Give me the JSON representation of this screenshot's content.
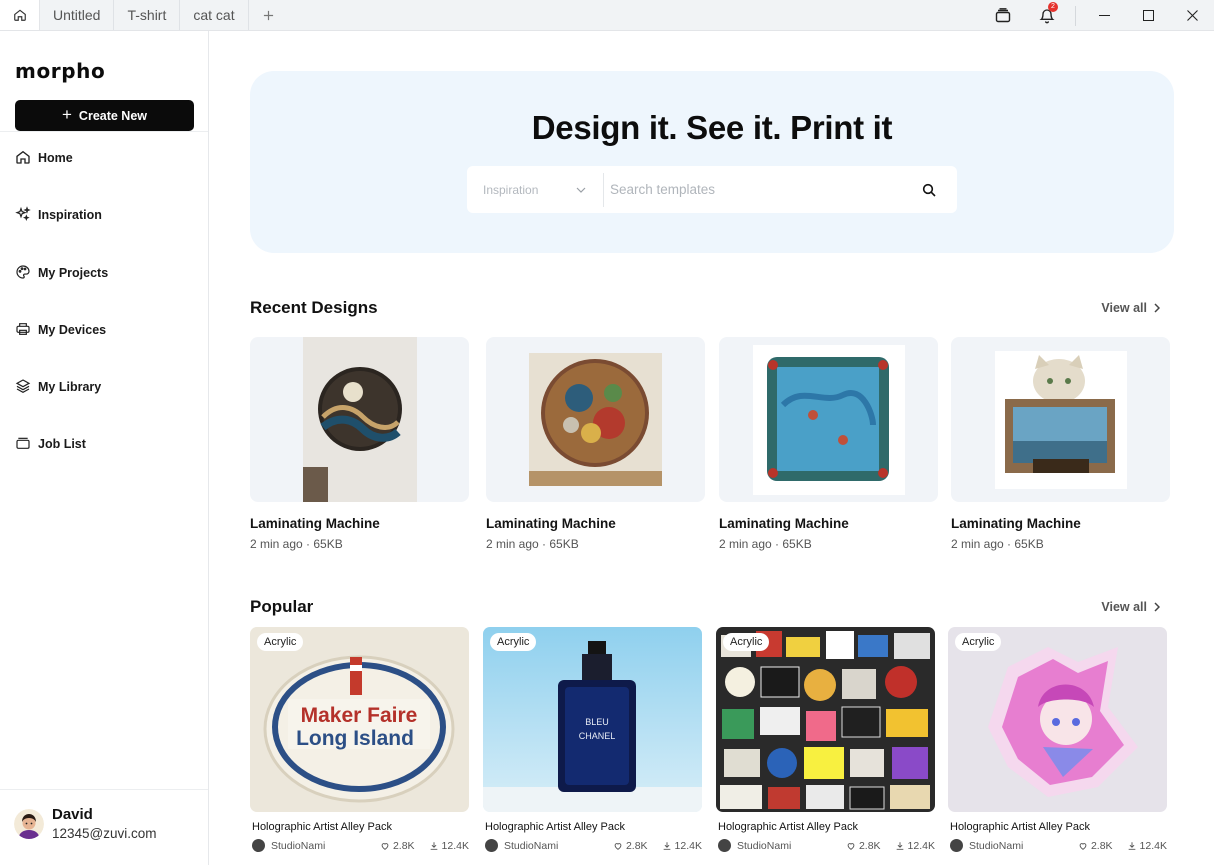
{
  "tabs": {
    "items": [
      {
        "label": "Untitled"
      },
      {
        "label": "T-shirt"
      },
      {
        "label": "cat cat"
      }
    ],
    "notification_count": "2"
  },
  "sidebar": {
    "logo": "morpho",
    "create_label": "Create New",
    "items": [
      {
        "label": "Home",
        "icon": "home-icon"
      },
      {
        "label": "Inspiration",
        "icon": "sparkles-icon"
      },
      {
        "label": "My Projects",
        "icon": "palette-icon"
      },
      {
        "label": "My Devices",
        "icon": "printer-icon"
      },
      {
        "label": "My Library",
        "icon": "layers-icon"
      },
      {
        "label": "Job List",
        "icon": "tray-icon"
      }
    ],
    "user": {
      "name": "David",
      "email": "12345@zuvi.com"
    }
  },
  "hero": {
    "title": "Design it. See it. Print it",
    "category": "Inspiration",
    "search_placeholder": "Search templates"
  },
  "recent": {
    "title": "Recent Designs",
    "view_all": "View all",
    "items": [
      {
        "name": "Laminating Machine",
        "meta": "2 min ago · 65KB"
      },
      {
        "name": "Laminating Machine",
        "meta": "2 min ago · 65KB"
      },
      {
        "name": "Laminating Machine",
        "meta": "2 min ago · 65KB"
      },
      {
        "name": "Laminating Machine",
        "meta": "2 min ago · 65KB"
      }
    ]
  },
  "popular": {
    "title": "Popular",
    "view_all": "View all",
    "items": [
      {
        "tag": "Acrylic",
        "name": "Holographic Artist Alley Pack",
        "author": "StudioNami",
        "likes": "2.8K",
        "downloads": "12.4K",
        "art_line1": "Maker Faire",
        "art_line2": "Long Island"
      },
      {
        "tag": "Acrylic",
        "name": "Holographic Artist Alley Pack",
        "author": "StudioNami",
        "likes": "2.8K",
        "downloads": "12.4K",
        "art_line1": "BLEU",
        "art_line2": "CHANEL"
      },
      {
        "tag": "Acrylic",
        "name": "Holographic Artist Alley Pack",
        "author": "StudioNami",
        "likes": "2.8K",
        "downloads": "12.4K"
      },
      {
        "tag": "Acrylic",
        "name": "Holographic Artist Alley Pack",
        "author": "StudioNami",
        "likes": "2.8K",
        "downloads": "12.4K"
      }
    ]
  },
  "colors": {
    "accent": "#0b0b0b",
    "hero_bg": "#eef6fd",
    "badge": "#e5322d"
  }
}
